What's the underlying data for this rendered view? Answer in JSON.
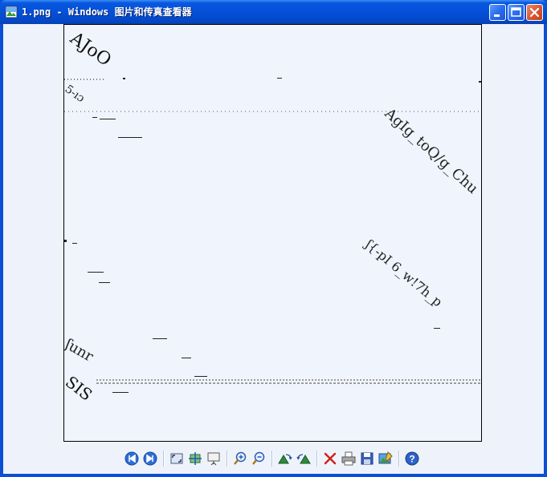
{
  "window": {
    "title": "1.png - Windows 图片和传真查看器"
  },
  "image": {
    "text_fragments": [
      "AJoO",
      "5-ıɔ",
      "AgIg_toQ/g_Chu",
      "ʃ{-pI 6_w!7h_p",
      "ʃunr",
      "SIS"
    ]
  },
  "toolbar": {
    "icons": [
      "previous-image-icon",
      "next-image-icon",
      "best-fit-icon",
      "actual-size-icon",
      "slideshow-icon",
      "zoom-in-icon",
      "zoom-out-icon",
      "rotate-clockwise-icon",
      "rotate-counterclockwise-icon",
      "delete-icon",
      "print-icon",
      "save-icon",
      "edit-icon",
      "help-icon"
    ]
  },
  "colors": {
    "titlebar": "#0550D8",
    "frame": "#0A4FD6",
    "client": "#EEF3FB",
    "close": "#D75A34"
  }
}
